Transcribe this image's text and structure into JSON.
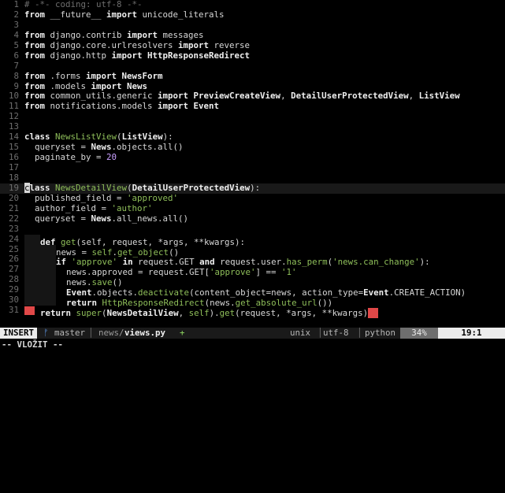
{
  "editor": {
    "lines": [
      {
        "n": "1",
        "t": [
          [
            "# -*- coding: utf-8 -*-",
            "c"
          ]
        ]
      },
      {
        "n": "2",
        "t": [
          [
            "from",
            "k"
          ],
          [
            " __future__ ",
            "o"
          ],
          [
            "import",
            "k"
          ],
          [
            " unicode_literals",
            "o"
          ]
        ]
      },
      {
        "n": "3",
        "t": []
      },
      {
        "n": "4",
        "t": [
          [
            "from",
            "k"
          ],
          [
            " django.contrib ",
            "o"
          ],
          [
            "import",
            "k"
          ],
          [
            " messages",
            "o"
          ]
        ]
      },
      {
        "n": "5",
        "t": [
          [
            "from",
            "k"
          ],
          [
            " django.core.urlresolvers ",
            "o"
          ],
          [
            "import",
            "k"
          ],
          [
            " reverse",
            "o"
          ]
        ]
      },
      {
        "n": "6",
        "t": [
          [
            "from",
            "k"
          ],
          [
            " django.http ",
            "o"
          ],
          [
            "import",
            "k"
          ],
          [
            " HttpResponseRedirect",
            "k"
          ]
        ]
      },
      {
        "n": "7",
        "t": []
      },
      {
        "n": "8",
        "t": [
          [
            "from",
            "k"
          ],
          [
            " .forms ",
            "o"
          ],
          [
            "import",
            "k"
          ],
          [
            " NewsForm",
            "k"
          ]
        ]
      },
      {
        "n": "9",
        "t": [
          [
            "from",
            "k"
          ],
          [
            " .models ",
            "o"
          ],
          [
            "import",
            "k"
          ],
          [
            " News",
            "k"
          ]
        ]
      },
      {
        "n": "10",
        "t": [
          [
            "from",
            "k"
          ],
          [
            " common_utils.generic ",
            "o"
          ],
          [
            "import",
            "k"
          ],
          [
            " PreviewCreateView",
            "k"
          ],
          [
            ", ",
            "o"
          ],
          [
            "DetailUserProtectedView",
            "k"
          ],
          [
            ", ",
            "o"
          ],
          [
            "ListView",
            "k"
          ]
        ]
      },
      {
        "n": "11",
        "t": [
          [
            "from",
            "k"
          ],
          [
            " notifications.models ",
            "o"
          ],
          [
            "import",
            "k"
          ],
          [
            " Event",
            "k"
          ]
        ]
      },
      {
        "n": "12",
        "t": []
      },
      {
        "n": "13",
        "t": []
      },
      {
        "n": "14",
        "t": [
          [
            "class",
            "k"
          ],
          [
            " ",
            "o"
          ],
          [
            "NewsListView",
            "f"
          ],
          [
            "(",
            "o"
          ],
          [
            "ListView",
            "k"
          ],
          [
            "):",
            "o"
          ]
        ]
      },
      {
        "n": "15",
        "t": [
          [
            "  queryset = ",
            "o"
          ],
          [
            "News",
            "k"
          ],
          [
            ".objects.all()",
            "o"
          ]
        ]
      },
      {
        "n": "16",
        "t": [
          [
            "  paginate_by = ",
            "o"
          ],
          [
            "20",
            "n"
          ]
        ]
      },
      {
        "n": "17",
        "t": []
      },
      {
        "n": "18",
        "t": []
      },
      {
        "n": "19",
        "cur": true,
        "t": [
          [
            "c",
            "cursor"
          ],
          [
            "lass",
            "k"
          ],
          [
            " ",
            "o"
          ],
          [
            "NewsDetailView",
            "f"
          ],
          [
            "(",
            "o"
          ],
          [
            "DetailUserProtectedView",
            "k"
          ],
          [
            "):",
            "o"
          ]
        ]
      },
      {
        "n": "20",
        "t": [
          [
            "  published_field = ",
            "o"
          ],
          [
            "'approved'",
            "s"
          ]
        ]
      },
      {
        "n": "21",
        "t": [
          [
            "  author_field = ",
            "o"
          ],
          [
            "'author'",
            "s"
          ]
        ]
      },
      {
        "n": "22",
        "t": [
          [
            "  queryset = ",
            "o"
          ],
          [
            "News",
            "k"
          ],
          [
            ".all_news.all()",
            "o"
          ]
        ]
      },
      {
        "n": "23",
        "t": []
      },
      {
        "n": "24",
        "ind": 1,
        "t": [
          [
            "def",
            "k"
          ],
          [
            " ",
            "o"
          ],
          [
            "get",
            "f"
          ],
          [
            "(self, request, *args, **kwargs):",
            "o"
          ]
        ]
      },
      {
        "n": "25",
        "ind": 2,
        "t": [
          [
            "news = ",
            "o"
          ],
          [
            "self",
            "f"
          ],
          [
            ".",
            "o"
          ],
          [
            "get_object",
            "f"
          ],
          [
            "()",
            "o"
          ]
        ]
      },
      {
        "n": "26",
        "ind": 2,
        "t": [
          [
            "if",
            "k"
          ],
          [
            " ",
            "o"
          ],
          [
            "'approve'",
            "s"
          ],
          [
            " ",
            "o"
          ],
          [
            "in",
            "k"
          ],
          [
            " request.GET ",
            "o"
          ],
          [
            "and",
            "k"
          ],
          [
            " request.user.",
            "o"
          ],
          [
            "has_perm",
            "f"
          ],
          [
            "(",
            "o"
          ],
          [
            "'news.can_change'",
            "s"
          ],
          [
            "):",
            "o"
          ]
        ]
      },
      {
        "n": "27",
        "ind": 2,
        "t": [
          [
            "  news.approved = request.GET[",
            "o"
          ],
          [
            "'approve'",
            "s"
          ],
          [
            "] == ",
            "o"
          ],
          [
            "'1'",
            "s"
          ]
        ]
      },
      {
        "n": "28",
        "ind": 2,
        "t": [
          [
            "  news.",
            "o"
          ],
          [
            "save",
            "f"
          ],
          [
            "()",
            "o"
          ]
        ]
      },
      {
        "n": "29",
        "ind": 2,
        "t": [
          [
            "  ",
            "o"
          ],
          [
            "Event",
            "k"
          ],
          [
            ".objects.",
            "o"
          ],
          [
            "deactivate",
            "f"
          ],
          [
            "(content_object=news, action_type=",
            "o"
          ],
          [
            "Event",
            "k"
          ],
          [
            ".CREATE_ACTION)",
            "o"
          ]
        ]
      },
      {
        "n": "30",
        "ind": 2,
        "t": [
          [
            "  ",
            "o"
          ],
          [
            "return",
            "k"
          ],
          [
            " ",
            "o"
          ],
          [
            "HttpResponseRedirect",
            "f"
          ],
          [
            "(news.",
            "o"
          ],
          [
            "get_absolute_url",
            "f"
          ],
          [
            "())",
            "o"
          ]
        ]
      },
      {
        "n": "31",
        "sign": true,
        "ind": 1,
        "t": [
          [
            "return",
            "k"
          ],
          [
            " ",
            "o"
          ],
          [
            "super",
            "f"
          ],
          [
            "(",
            "o"
          ],
          [
            "NewsDetailView",
            "k"
          ],
          [
            ", ",
            "o"
          ],
          [
            "self",
            "f"
          ],
          [
            ").",
            "o"
          ],
          [
            "get",
            "f"
          ],
          [
            "(request, *args, **kwargs)",
            "o"
          ],
          [
            "**",
            "err"
          ]
        ]
      }
    ]
  },
  "statusline": {
    "mode": "INSERT",
    "branch_icon": "git-branch-icon",
    "branch_glyph": "ᚠ",
    "branch": "master",
    "path_dir": "news/",
    "path_file": "views.py",
    "modified": "+",
    "format": "unix",
    "encoding": "utf-8",
    "filetype": "python",
    "percent": "34%",
    "position": "19:1"
  },
  "cmdline": {
    "text": "-- VLOŽIT --"
  },
  "colors": {
    "keyword": "#f0f0f0",
    "string": "#8fbf5a",
    "number": "#c9a0ff",
    "error": "#e04848",
    "mode_bg": "#ececec",
    "statusline_bg": "#1a1a1a",
    "percent_bg": "#6e6e6e",
    "position_bg": "#ececec",
    "branch_fg": "#5a8fd8",
    "modified_fg": "#8fd860"
  }
}
